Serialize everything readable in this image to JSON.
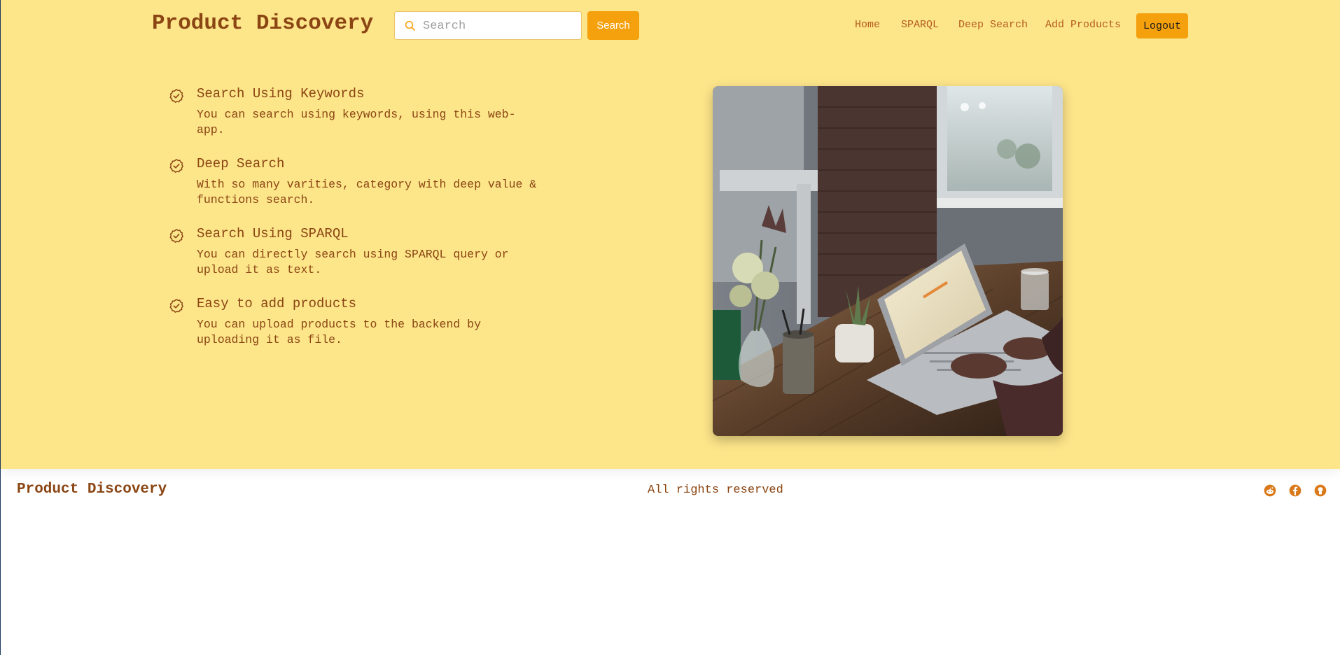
{
  "header": {
    "brand": "Product Discovery",
    "search": {
      "placeholder": "Search",
      "button_label": "Search"
    },
    "nav": [
      {
        "label": "Home"
      },
      {
        "label": "SPARQL"
      },
      {
        "label": "Deep Search"
      },
      {
        "label": "Add Products"
      }
    ],
    "logout_label": "Logout"
  },
  "features": [
    {
      "title": "Search Using Keywords",
      "description": "You can search using keywords, using this web-app."
    },
    {
      "title": "Deep Search",
      "description": "With so many varities, category with deep value & functions search."
    },
    {
      "title": "Search Using SPARQL",
      "description": "You can directly search using SPARQL query or upload it as text."
    },
    {
      "title": "Easy to add products",
      "description": "You can upload products to the backend by uploading it as file."
    }
  ],
  "footer": {
    "brand": "Product Discovery",
    "rights": "All rights reserved",
    "social_icons": [
      "reddit-icon",
      "facebook-icon",
      "github-icon"
    ]
  },
  "colors": {
    "hero_bg": "#fde58a",
    "accent": "#f5a00d",
    "text_brown": "#8a4513"
  }
}
